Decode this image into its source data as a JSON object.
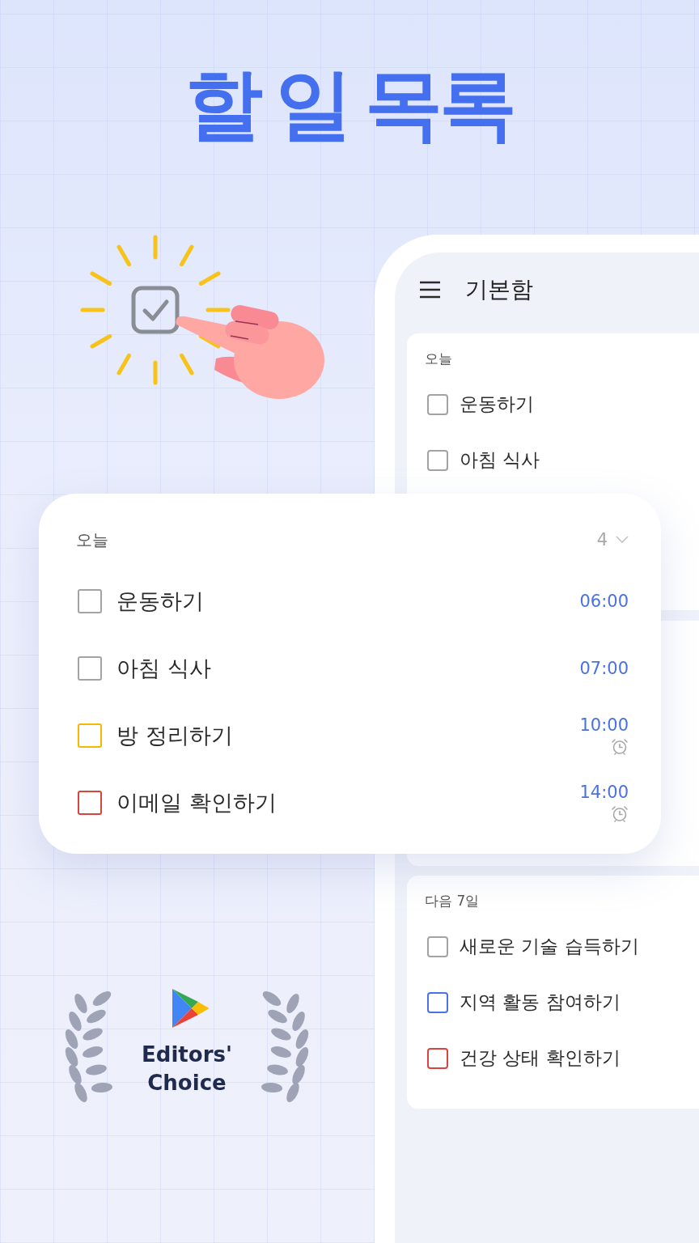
{
  "title": "할 일 목록",
  "phone": {
    "header": {
      "title": "기본함"
    },
    "sections": [
      {
        "label": "오늘",
        "tasks": [
          {
            "title": "운동하기",
            "checked": false,
            "color": "#a3a3a3"
          },
          {
            "title": "아침 식사",
            "checked": false,
            "color": "#a3a3a3"
          }
        ]
      },
      {
        "label": "다음 7일",
        "tasks": [
          {
            "title": "새로운 기술 습득하기",
            "checked": false,
            "color": "#a3a3a3"
          },
          {
            "title": "지역 활동 참여하기",
            "checked": false,
            "color": "#4a72e8"
          },
          {
            "title": "건강 상태 확인하기",
            "checked": false,
            "color": "#d9443f"
          }
        ]
      }
    ]
  },
  "today_card": {
    "label": "오늘",
    "count": "4",
    "tasks": [
      {
        "title": "운동하기",
        "checked": false,
        "color": "#a3a3a3",
        "time": "06:00",
        "alarm": false
      },
      {
        "title": "아침 식사",
        "checked": false,
        "color": "#a3a3a3",
        "time": "07:00",
        "alarm": false
      },
      {
        "title": "방 정리하기",
        "checked": false,
        "color": "#f5b800",
        "time": "10:00",
        "alarm": true
      },
      {
        "title": "이메일 확인하기",
        "checked": false,
        "color": "#d9443f",
        "time": "14:00",
        "alarm": true
      }
    ]
  },
  "badge": {
    "lines": [
      "Editors'",
      "Choice"
    ]
  }
}
